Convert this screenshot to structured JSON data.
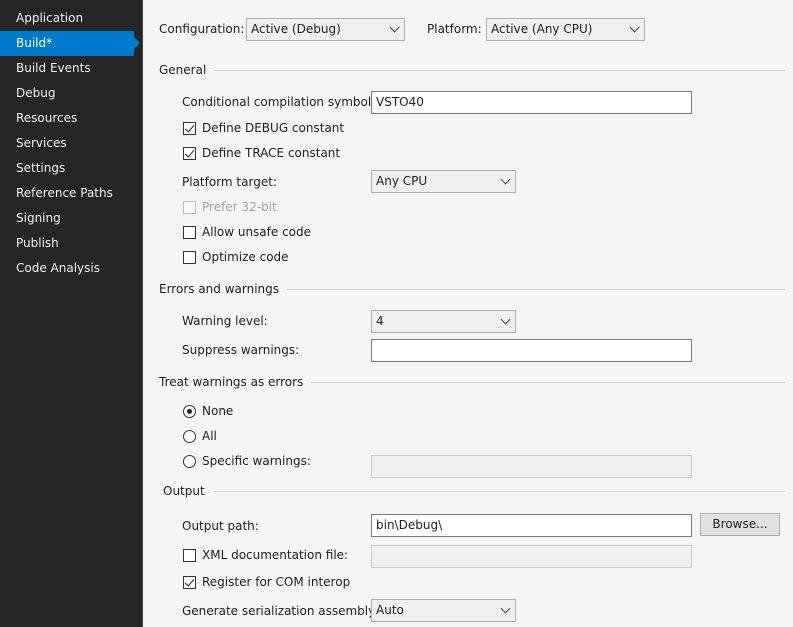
{
  "sidebar": {
    "items": [
      {
        "label": "Application"
      },
      {
        "label": "Build*"
      },
      {
        "label": "Build Events"
      },
      {
        "label": "Debug"
      },
      {
        "label": "Resources"
      },
      {
        "label": "Services"
      },
      {
        "label": "Settings"
      },
      {
        "label": "Reference Paths"
      },
      {
        "label": "Signing"
      },
      {
        "label": "Publish"
      },
      {
        "label": "Code Analysis"
      }
    ],
    "active_index": 1
  },
  "top": {
    "configuration_label": "Configuration:",
    "configuration_value": "Active (Debug)",
    "platform_label": "Platform:",
    "platform_value": "Active (Any CPU)"
  },
  "general": {
    "title": "General",
    "conditional_symbols_label": "Conditional compilation symbols:",
    "conditional_symbols_value": "VSTO40",
    "define_debug_label": "Define DEBUG constant",
    "define_debug_checked": true,
    "define_trace_label": "Define TRACE constant",
    "define_trace_checked": true,
    "platform_target_label": "Platform target:",
    "platform_target_value": "Any CPU",
    "prefer32_label": "Prefer 32-bit",
    "prefer32_checked": false,
    "allow_unsafe_label": "Allow unsafe code",
    "allow_unsafe_checked": false,
    "optimize_label": "Optimize code",
    "optimize_checked": false
  },
  "errors": {
    "title": "Errors and warnings",
    "warning_level_label": "Warning level:",
    "warning_level_value": "4",
    "suppress_label": "Suppress warnings:",
    "suppress_value": ""
  },
  "treat": {
    "title": "Treat warnings as errors",
    "none_label": "None",
    "all_label": "All",
    "specific_label": "Specific warnings:",
    "specific_value": "",
    "selected": "None"
  },
  "output": {
    "title": "Output",
    "output_path_label": "Output path:",
    "output_path_value": "bin\\Debug\\",
    "browse_label": "Browse...",
    "xml_doc_label": "XML documentation file:",
    "xml_doc_checked": false,
    "xml_doc_value": "",
    "register_com_label": "Register for COM interop",
    "register_com_checked": true,
    "serialization_label": "Generate serialization assembly:",
    "serialization_value": "Auto"
  },
  "colors": {
    "sidebar_bg": "#252526",
    "accent": "#007acc",
    "highlight": "#ffff1a"
  }
}
